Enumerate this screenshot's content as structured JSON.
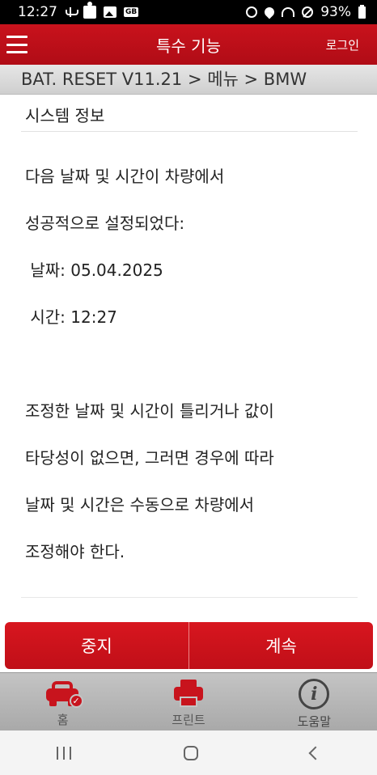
{
  "status_bar": {
    "time": "12:27",
    "battery": "93%",
    "left_icons": [
      "usb-icon",
      "puzzle-icon",
      "image-icon"
    ],
    "gb_badge": "GB",
    "right_icons": [
      "alarm-icon",
      "location-icon",
      "wifi-icon",
      "no-disturb-icon",
      "battery-icon"
    ]
  },
  "header": {
    "title": "특수 기능",
    "login": "로그인",
    "menu_icon": "hamburger-menu-icon"
  },
  "breadcrumb": "BAT. RESET V11.21 > 메뉴 > BMW",
  "content": {
    "section_title": "시스템 정보",
    "message_lines": [
      "다음 날짜 및 시간이 차량에서",
      "성공적으로 설정되었다:",
      " 날짜: 05.04.2025",
      " 시간: 12:27",
      "",
      "조정한 날짜 및 시간이 틀리거나 값이",
      "타당성이 없으면, 그러면 경우에 따라",
      "날짜 및 시간은 수동으로 차량에서",
      "조정해야 한다."
    ]
  },
  "actions": {
    "stop": "중지",
    "continue": "계속"
  },
  "tab_bar": {
    "home": {
      "label": "홈",
      "icon": "car-check-icon"
    },
    "print": {
      "label": "프린트",
      "icon": "printer-icon"
    },
    "help": {
      "label": "도움말",
      "icon": "info-icon",
      "glyph": "i"
    }
  },
  "colors": {
    "accent_red": "#c8141d",
    "tab_bar_gray": "#b5b5b5"
  }
}
